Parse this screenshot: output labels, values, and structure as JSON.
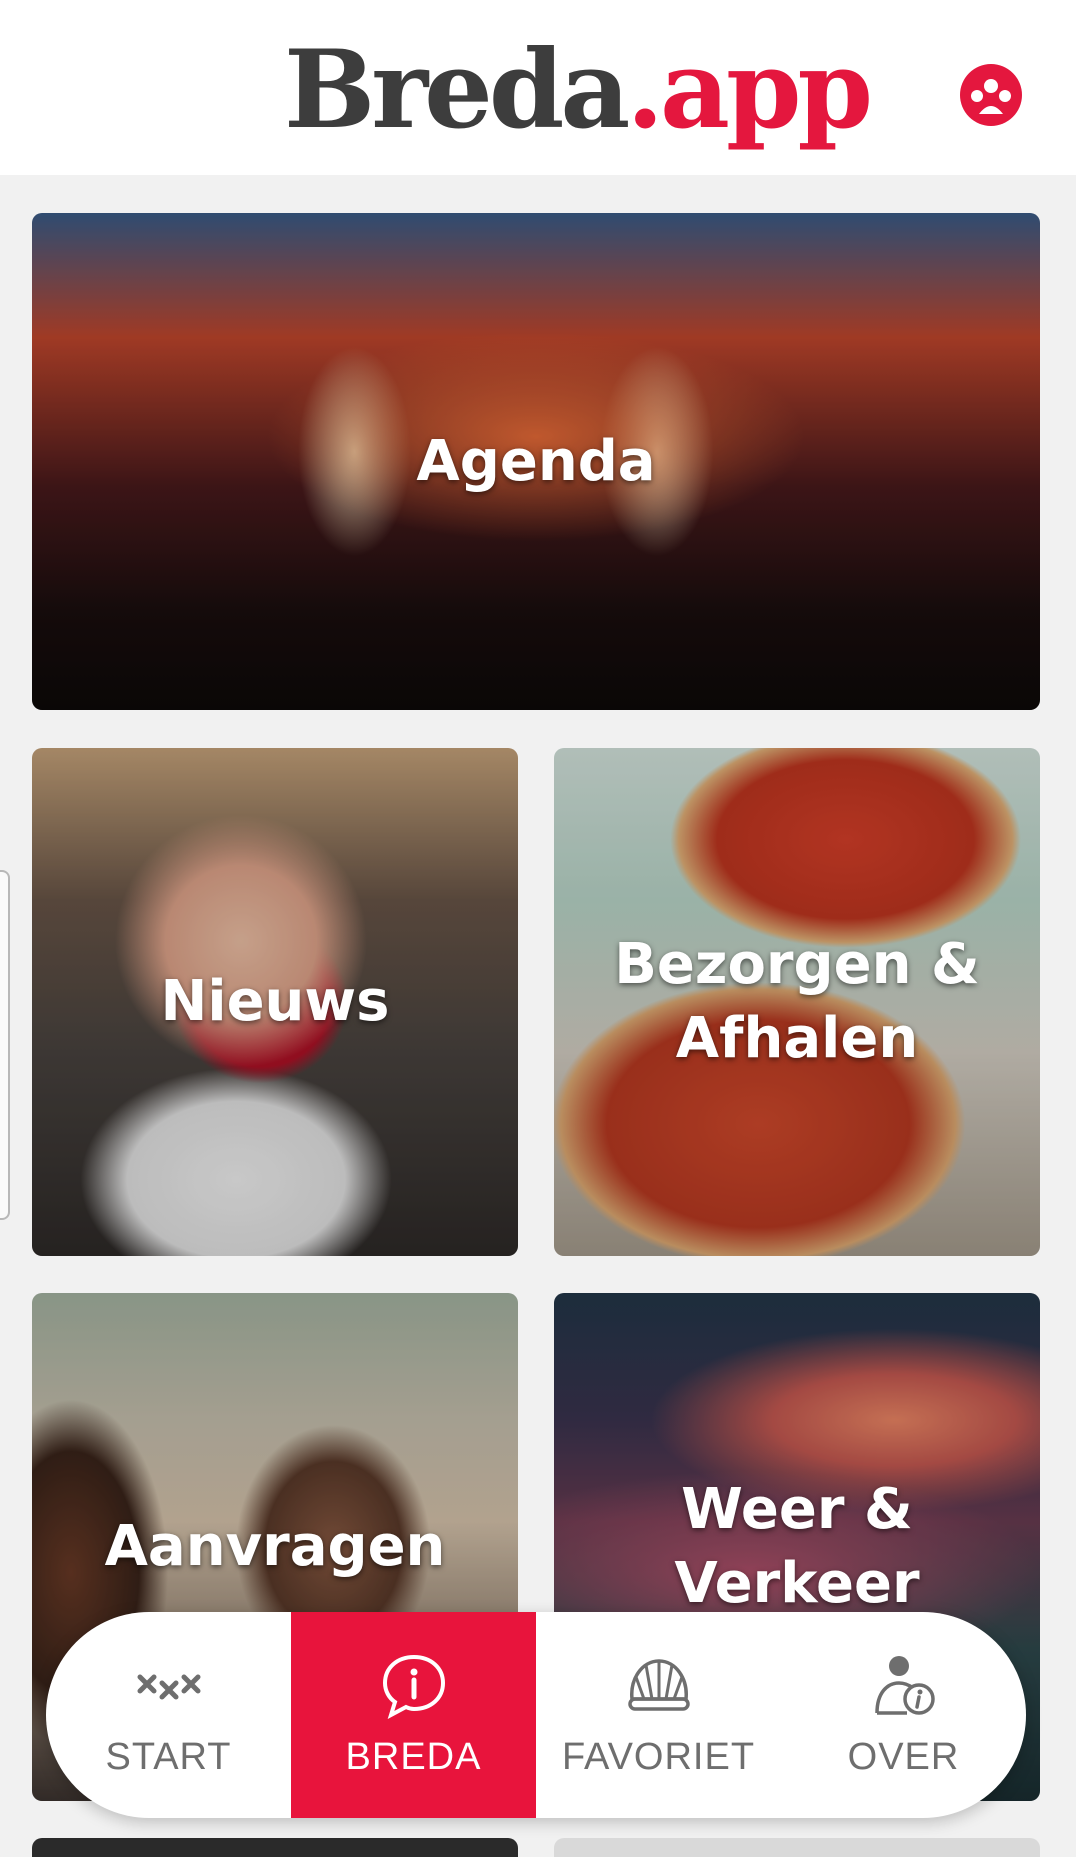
{
  "header": {
    "logo_main": "Breda",
    "logo_dot": ".",
    "logo_app": "app",
    "brand_color": "#e4173e",
    "profile_icon": "user-group-icon"
  },
  "tiles": [
    {
      "label": "Agenda"
    },
    {
      "label": "Nieuws"
    },
    {
      "label": "Bezorgen &\nAfhalen"
    },
    {
      "label": "Aanvragen"
    },
    {
      "label": "Weer &\nVerkeer"
    }
  ],
  "bottom_nav": {
    "active_color": "#e8143c",
    "items": [
      {
        "label": "START",
        "icon": "xxx-crosses-icon",
        "active": false
      },
      {
        "label": "BREDA",
        "icon": "info-chat-icon",
        "active": true
      },
      {
        "label": "FAVORIET",
        "icon": "shell-icon",
        "active": false
      },
      {
        "label": "OVER",
        "icon": "user-info-icon",
        "active": false
      }
    ]
  }
}
